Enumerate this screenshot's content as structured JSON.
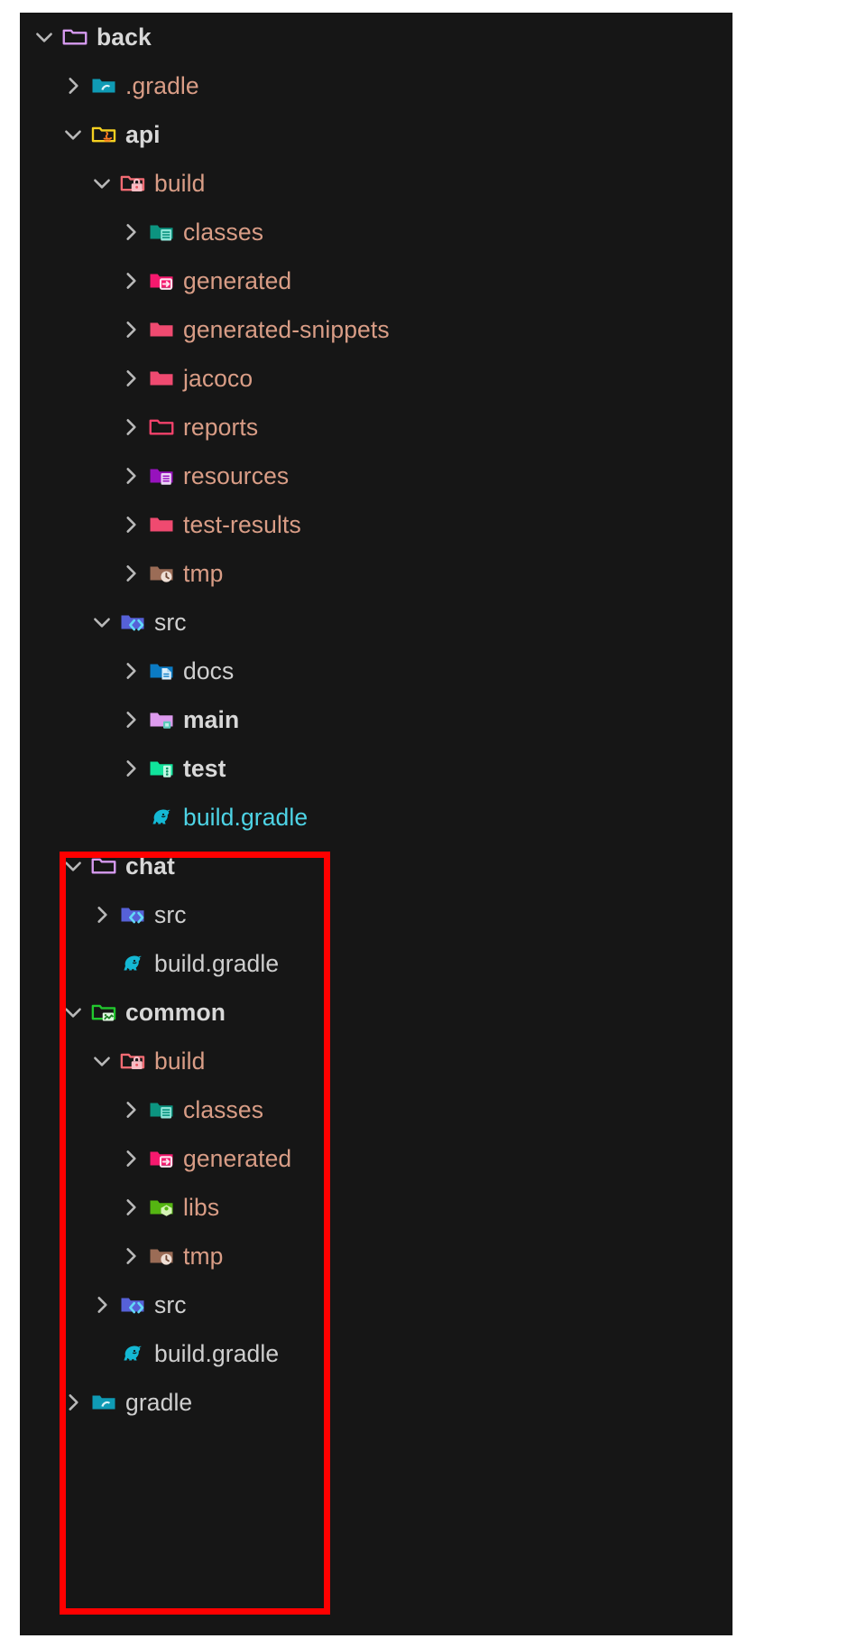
{
  "panel": {
    "background": "#161616",
    "highlight_color": "#ff0000"
  },
  "colors": {
    "ignored_text": "#d99d86",
    "normal_text": "#cfcfcf",
    "modified_text": "#4ed4e6",
    "highlight_border": "#ff0000"
  },
  "tree": {
    "rows": [
      {
        "label": "back",
        "indent": 0,
        "chevron": "chevron-down",
        "icon": "folder-outline-violet",
        "color": "white",
        "bold": true
      },
      {
        "label": ".gradle",
        "indent": 1,
        "chevron": "chevron-right",
        "icon": "folder-gradle-teal",
        "color": "salmon",
        "bold": false
      },
      {
        "label": "api",
        "indent": 1,
        "chevron": "chevron-down",
        "icon": "folder-java-yellow",
        "color": "white",
        "bold": true
      },
      {
        "label": "build",
        "indent": 2,
        "chevron": "chevron-down",
        "icon": "folder-build-red",
        "color": "salmon",
        "bold": false
      },
      {
        "label": "classes",
        "indent": 3,
        "chevron": "chevron-right",
        "icon": "folder-classes-teal",
        "color": "salmon",
        "bold": false
      },
      {
        "label": "generated",
        "indent": 3,
        "chevron": "chevron-right",
        "icon": "folder-generated-pink",
        "color": "salmon",
        "bold": false
      },
      {
        "label": "generated-snippets",
        "indent": 3,
        "chevron": "chevron-right",
        "icon": "folder-plain-pink",
        "color": "salmon",
        "bold": false
      },
      {
        "label": "jacoco",
        "indent": 3,
        "chevron": "chevron-right",
        "icon": "folder-plain-pink",
        "color": "salmon",
        "bold": false
      },
      {
        "label": "reports",
        "indent": 3,
        "chevron": "chevron-right",
        "icon": "folder-outline-pink",
        "color": "salmon",
        "bold": false
      },
      {
        "label": "resources",
        "indent": 3,
        "chevron": "chevron-right",
        "icon": "folder-resources-purple",
        "color": "salmon",
        "bold": false
      },
      {
        "label": "test-results",
        "indent": 3,
        "chevron": "chevron-right",
        "icon": "folder-plain-pink",
        "color": "salmon",
        "bold": false
      },
      {
        "label": "tmp",
        "indent": 3,
        "chevron": "chevron-right",
        "icon": "folder-tmp-brown",
        "color": "salmon",
        "bold": false
      },
      {
        "label": "src",
        "indent": 2,
        "chevron": "chevron-down",
        "icon": "folder-src-indigo",
        "color": "white",
        "bold": false
      },
      {
        "label": "docs",
        "indent": 3,
        "chevron": "chevron-right",
        "icon": "folder-docs-blue",
        "color": "white",
        "bold": false
      },
      {
        "label": "main",
        "indent": 3,
        "chevron": "chevron-right",
        "icon": "folder-main-violet",
        "color": "white",
        "bold": true
      },
      {
        "label": "test",
        "indent": 3,
        "chevron": "chevron-right",
        "icon": "folder-test-green",
        "color": "white",
        "bold": true
      },
      {
        "label": "build.gradle",
        "indent": 3,
        "chevron": "none",
        "icon": "gradle-elephant",
        "color": "cyan",
        "bold": false
      },
      {
        "label": "chat",
        "indent": 1,
        "chevron": "chevron-down",
        "icon": "folder-outline-violet",
        "color": "white",
        "bold": true
      },
      {
        "label": "src",
        "indent": 2,
        "chevron": "chevron-right",
        "icon": "folder-src-indigo",
        "color": "white",
        "bold": false
      },
      {
        "label": "build.gradle",
        "indent": 2,
        "chevron": "none",
        "icon": "gradle-elephant",
        "color": "white",
        "bold": false
      },
      {
        "label": "common",
        "indent": 1,
        "chevron": "chevron-down",
        "icon": "folder-common-green",
        "color": "white",
        "bold": true
      },
      {
        "label": "build",
        "indent": 2,
        "chevron": "chevron-down",
        "icon": "folder-build-red",
        "color": "salmon",
        "bold": false
      },
      {
        "label": "classes",
        "indent": 3,
        "chevron": "chevron-right",
        "icon": "folder-classes-teal",
        "color": "salmon",
        "bold": false
      },
      {
        "label": "generated",
        "indent": 3,
        "chevron": "chevron-right",
        "icon": "folder-generated-pink",
        "color": "salmon",
        "bold": false
      },
      {
        "label": "libs",
        "indent": 3,
        "chevron": "chevron-right",
        "icon": "folder-libs-green",
        "color": "salmon",
        "bold": false
      },
      {
        "label": "tmp",
        "indent": 3,
        "chevron": "chevron-right",
        "icon": "folder-tmp-brown",
        "color": "salmon",
        "bold": false
      },
      {
        "label": "src",
        "indent": 2,
        "chevron": "chevron-right",
        "icon": "folder-src-indigo",
        "color": "white",
        "bold": false
      },
      {
        "label": "build.gradle",
        "indent": 2,
        "chevron": "none",
        "icon": "gradle-elephant",
        "color": "white",
        "bold": false
      },
      {
        "label": "gradle",
        "indent": 1,
        "chevron": "chevron-right",
        "icon": "folder-gradle-teal",
        "color": "white",
        "bold": false
      }
    ]
  }
}
